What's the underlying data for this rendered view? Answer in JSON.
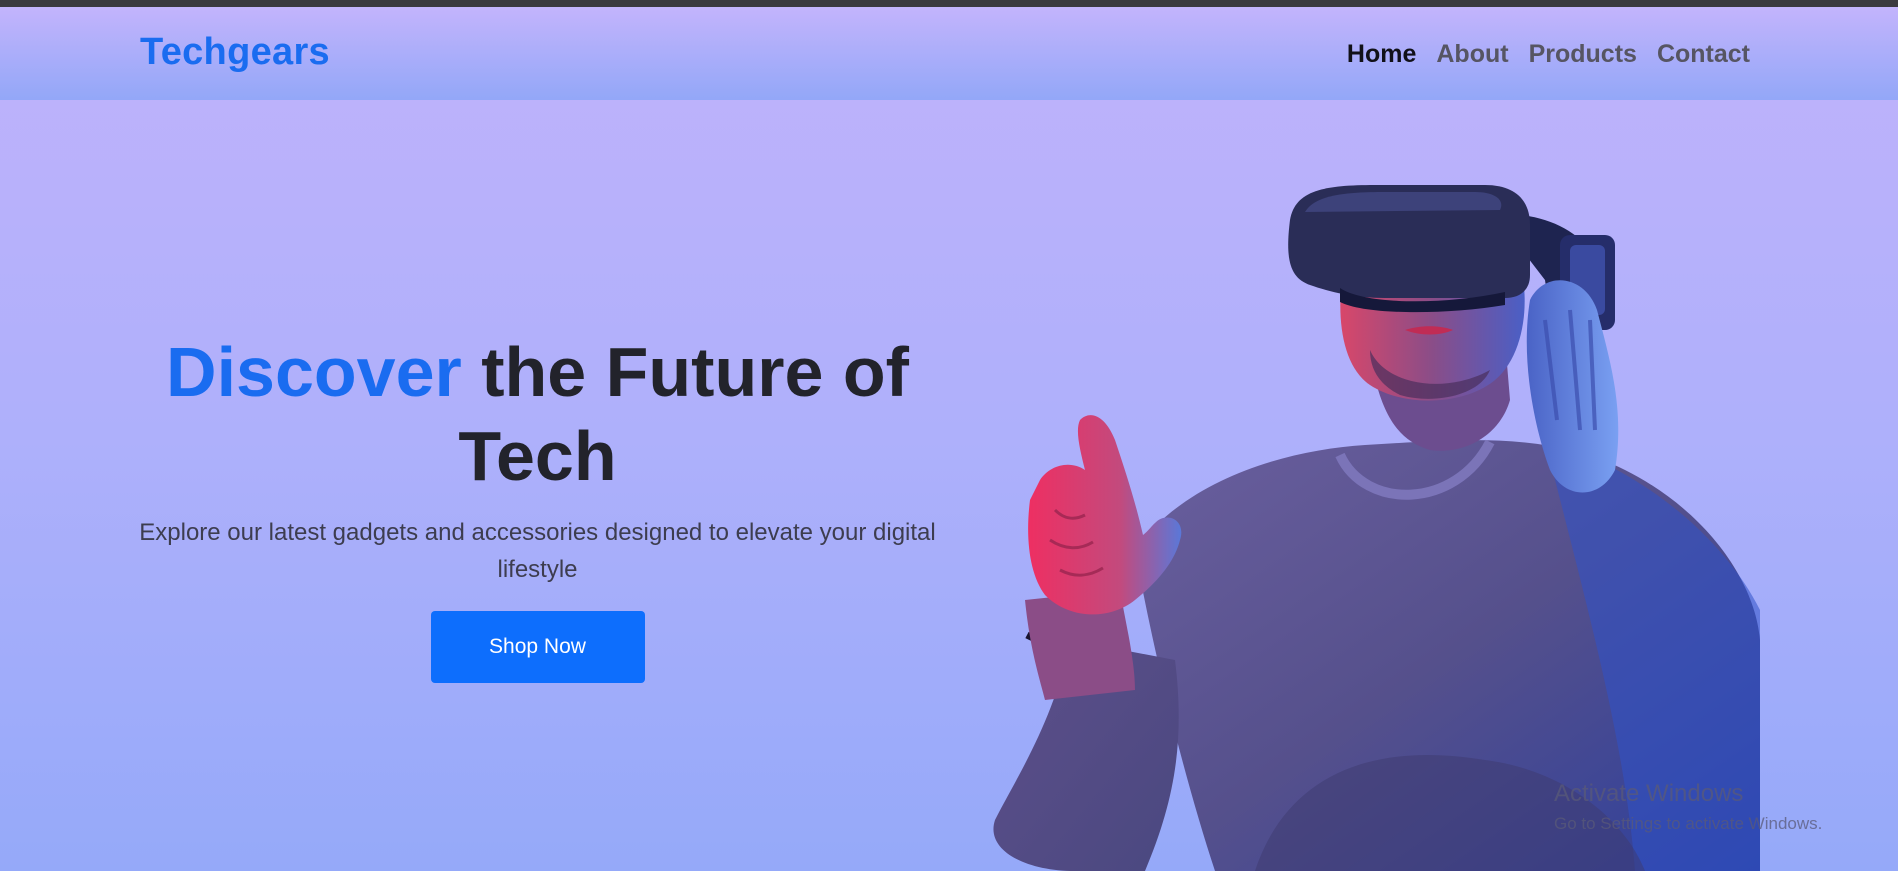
{
  "brand": {
    "name": "Techgears",
    "color": "#1a6cf0"
  },
  "nav": {
    "items": [
      {
        "label": "Home",
        "active": true
      },
      {
        "label": "About",
        "active": false
      },
      {
        "label": "Products",
        "active": false
      },
      {
        "label": "Contact",
        "active": false
      }
    ]
  },
  "hero": {
    "title_accent": "Discover",
    "title_rest": " the Future of Tech",
    "subtitle": "Explore our latest gadgets and accessories designed to elevate your digital lifestyle",
    "cta_label": "Shop Now",
    "image": "person-wearing-vr-headset-pointing"
  },
  "watermark": {
    "title": "Activate Windows",
    "subtitle": "Go to Settings to activate Windows."
  },
  "colors": {
    "accent": "#0d6efd",
    "background_top": "#c0b2fb",
    "background_bottom": "#95a9f9",
    "heading": "#22232b"
  }
}
